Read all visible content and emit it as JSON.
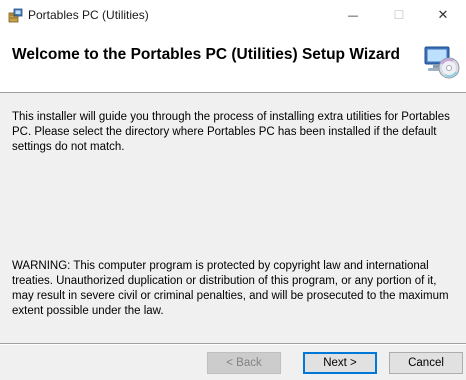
{
  "window": {
    "title": "Portables PC (Utilities)",
    "controls": {
      "minimize": "—",
      "maximize": "☐",
      "close": "✕"
    }
  },
  "header": {
    "title": "Welcome to the Portables PC (Utilities) Setup Wizard"
  },
  "content": {
    "intro": "This installer will guide you through the process of installing extra utilities for Portables PC. Please select the directory where Portables PC has been installed if the default settings do not match.",
    "warning": "WARNING: This computer program is protected by copyright law and international treaties. Unauthorized duplication or distribution of this program, or any portion of it, may result in severe civil or criminal penalties, and will be prosecuted to the maximum extent possible under the law."
  },
  "buttons": {
    "back": "< Back",
    "next": "Next >",
    "cancel": "Cancel"
  },
  "colors": {
    "accent": "#0078d7",
    "dialog_background": "#f0f0f0",
    "header_background": "#ffffff"
  }
}
